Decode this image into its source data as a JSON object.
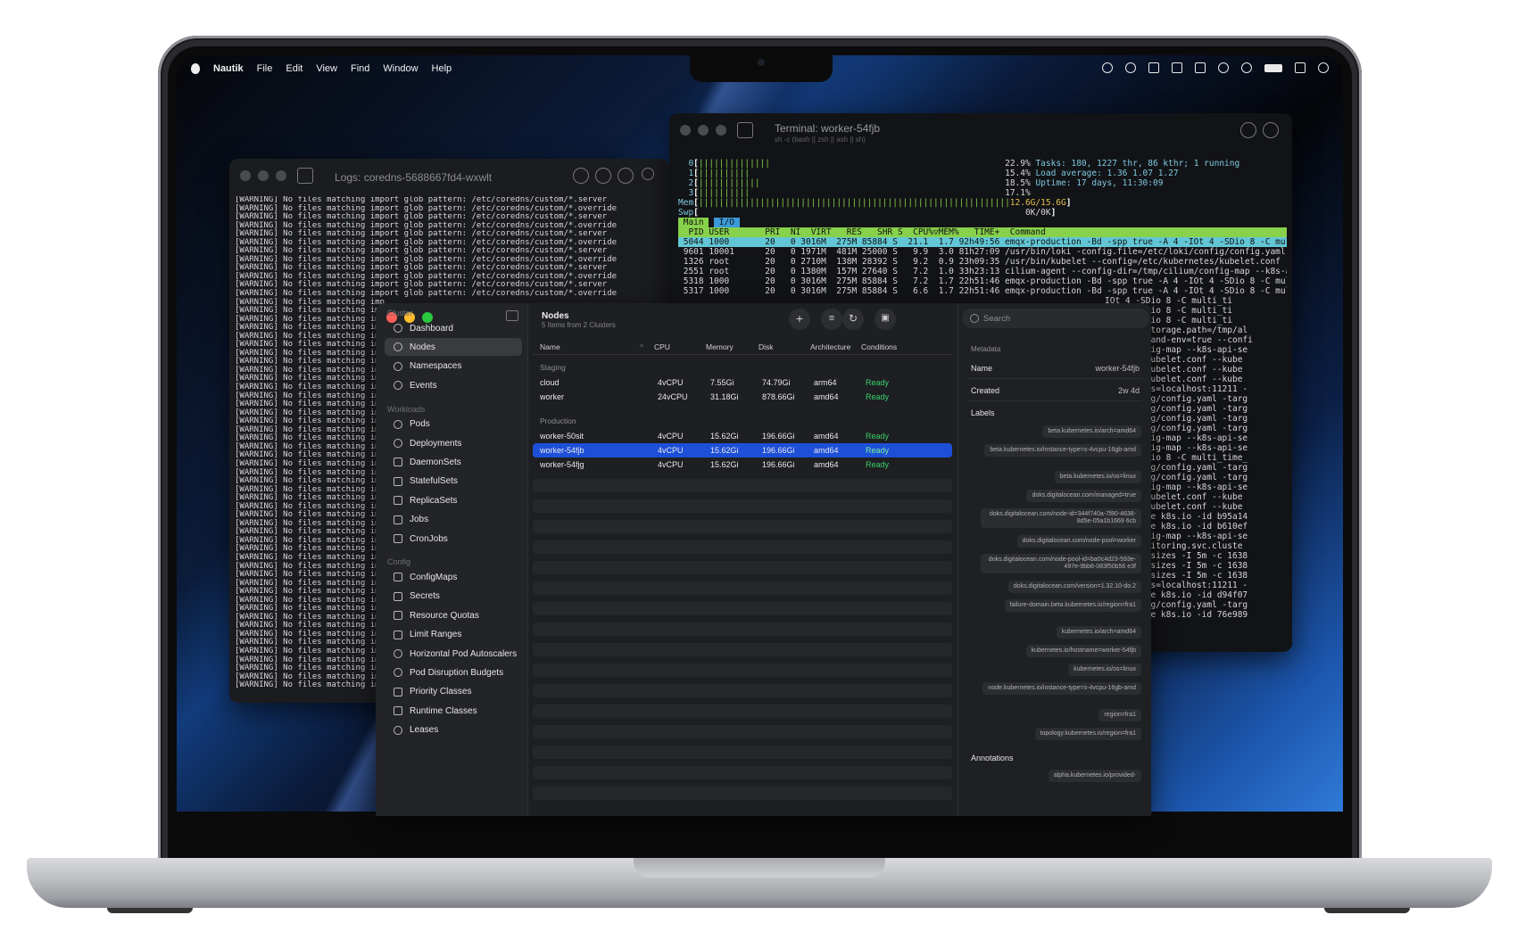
{
  "menubar": {
    "app": "Nautik",
    "items": [
      "File",
      "Edit",
      "View",
      "Find",
      "Window",
      "Help"
    ]
  },
  "logs_window": {
    "title": "Logs: coredns-5688667fd4-wxwlt",
    "lines": [
      "[WARNING] No files matching import glob pattern: /etc/coredns/custom/*.server",
      "[WARNING] No files matching import glob pattern: /etc/coredns/custom/*.override",
      "[WARNING] No files matching import glob pattern: /etc/coredns/custom/*.server",
      "[WARNING] No files matching import glob pattern: /etc/coredns/custom/*.override",
      "[WARNING] No files matching import glob pattern: /etc/coredns/custom/*.server",
      "[WARNING] No files matching import glob pattern: /etc/coredns/custom/*.override",
      "[WARNING] No files matching import glob pattern: /etc/coredns/custom/*.server",
      "[WARNING] No files matching import glob pattern: /etc/coredns/custom/*.override",
      "[WARNING] No files matching import glob pattern: /etc/coredns/custom/*.server",
      "[WARNING] No files matching import glob pattern: /etc/coredns/custom/*.override",
      "[WARNING] No files matching import glob pattern: /etc/coredns/custom/*.server",
      "[WARNING] No files matching import glob pattern: /etc/coredns/custom/*.override"
    ],
    "truncated_line": "[WARNING] No files matching imp",
    "truncated_count": 46
  },
  "terminal_window": {
    "title": "Terminal: worker-54fjb",
    "subtitle": "sh -c (bash || zsh || ash || sh)",
    "cpu_rows": [
      {
        "label": "0",
        "bar": "||||||||||||||",
        "pct": "22.9%"
      },
      {
        "label": "1",
        "bar": "||||||||||",
        "pct": "15.4%"
      },
      {
        "label": "2",
        "bar": "||||||||||||",
        "pct": "18.5%"
      },
      {
        "label": "3",
        "bar": "||||||||||",
        "pct": "17.1%"
      }
    ],
    "mem_bar": "|||||||||||||||||||||||||||||||||||||||||||||||||||||||||||||",
    "mem_value": "12.6G/15.6G",
    "swp_value": "0K/0K",
    "tasks": "Tasks: 180, 1227 thr, 86 kthr; 1 running",
    "load": "Load average: 1.36 1.07 1.27",
    "uptime": "Uptime: 17 days, 11:30:09",
    "tab_main": "Main",
    "tab_io": "I/O",
    "proc_header": "  PID USER       PRI  NI  VIRT   RES   SHR S  CPU%▽MEM%   TIME+  Command",
    "processes": [
      " 5044 1000       20   0 3016M  275M 85884 S  21.1  1.7 92h49:56 emqx-production -Bd -spp true -A 4 -IOt 4 -SDio 8 -C multi_ti",
      " 9601 10001      20   0 1971M  481M 25000 S   9.9  3.0 81h27:09 /usr/bin/loki -config.file=/etc/loki/config/config.yaml -targ",
      " 1326 root       20   0 2710M  138M 28392 S   9.2  0.9 23h09:35 /usr/bin/kubelet --config=/etc/kubernetes/kubelet.conf --kube",
      " 2551 root       20   0 1380M  157M 27640 S   7.2  1.0 33h23:13 cilium-agent --config-dir=/tmp/cilium/config-map --k8s-api-se",
      " 5318 1000       20   0 3016M  275M 85884 S   7.2  1.7 22h51:46 emqx-production -Bd -spp true -A 4 -IOt 4 -SDio 8 -C multi_ti",
      " 5317 1000       20   0 3016M  275M 85884 S   6.6  1.7 22h51:46 emqx-production -Bd -spp true -A 4 -IOt 4 -SDio 8 -C multi_ti"
    ],
    "right_fragments": [
      "IOt 4 -SDio 8 -C multi_ti",
      "IOt 4 -SDio 8 -C multi_ti",
      "IOt 4 -SDio 8 -C multi_ti",
      "alloy --storage.path=/tmp/al",
      "onfig.expand-env=true --confi",
      "lium/config-map --k8s-api-se",
      "ernetes/kubelet.conf --kube",
      "",
      "ernetes/kubelet.conf --kube",
      "ernetes/kubelet.conf --kube",
      "ed.address=localhost:11211 -",
      "oki/config/config.yaml -targ",
      "oki/config/config.yaml -targ",
      "oki/config/config.yaml -targ",
      "oki/config/config.yaml -targ",
      "lium/config-map --k8s-api-se",
      "",
      "lium/config-map --k8s-api-se",
      "IOt 4 -SDio 8 -C multi_time_",
      "oki/config/config.yaml -targ",
      "oki/config/config.yaml -targ",
      "lium/config-map --k8s-api-se",
      "ernetes/kubelet.conf --kube",
      "ernetes/kubelet.conf --kube",
      "-namespace k8s.io -id b95a14",
      "-namespace k8s.io -id b610ef",
      "lium/config-map --k8s-api-se",
      "teway.monitoring.svc.cluste",
      "rn,track_sizes -I 5m -c 1638",
      "rn,track_sizes -I 5m -c 1638",
      "rn,track_sizes -I 5m -c 1638",
      "ed.address=localhost:11211 -",
      "-namespace k8s.io -id d94f07",
      "oki/config/config.yaml -targ",
      "-namespace k8s.io -id 76e989"
    ]
  },
  "nautik": {
    "sidebar": {
      "sections": [
        {
          "title": "Cluster",
          "items": [
            "Dashboard",
            "Nodes",
            "Namespaces",
            "Events"
          ]
        },
        {
          "title": "Workloads",
          "items": [
            "Pods",
            "Deployments",
            "DaemonSets",
            "StatefulSets",
            "ReplicaSets",
            "Jobs",
            "CronJobs"
          ]
        },
        {
          "title": "Config",
          "items": [
            "ConfigMaps",
            "Secrets",
            "Resource Quotas",
            "Limit Ranges",
            "Horizontal Pod Autoscalers",
            "Pod Disruption Budgets",
            "Priority Classes",
            "Runtime Classes",
            "Leases"
          ]
        }
      ],
      "active": "Nodes"
    },
    "header": {
      "title": "Nodes",
      "subtitle": "5 Items from 2 Clusters"
    },
    "search_placeholder": "Search",
    "columns": [
      "Name",
      "CPU",
      "Memory",
      "Disk",
      "Architecture",
      "Conditions"
    ],
    "groups": [
      {
        "name": "Staging",
        "rows": [
          [
            "cloud",
            "4vCPU",
            "7.55Gi",
            "74.79Gi",
            "arm64",
            "Ready"
          ],
          [
            "worker",
            "24vCPU",
            "31.18Gi",
            "878.66Gi",
            "amd64",
            "Ready"
          ]
        ]
      },
      {
        "name": "Production",
        "rows": [
          [
            "worker-50sit",
            "4vCPU",
            "15.62Gi",
            "196.66Gi",
            "amd64",
            "Ready"
          ],
          [
            "worker-54fjb",
            "4vCPU",
            "15.62Gi",
            "196.66Gi",
            "amd64",
            "Ready"
          ],
          [
            "worker-54fjg",
            "4vCPU",
            "15.62Gi",
            "196.66Gi",
            "amd64",
            "Ready"
          ]
        ]
      }
    ],
    "selected_row": "worker-54fjb",
    "detail": {
      "section": "Metadata",
      "name_label": "Name",
      "name_value": "worker-54fjb",
      "created_label": "Created",
      "created_value": "2w 4d",
      "labels_title": "Labels",
      "labels": [
        "beta.kubernetes.io/arch=amd64",
        "beta.kubernetes.io/instance-type=s-4vcpu-16gb-amd",
        "beta.kubernetes.io/os=linux",
        "doks.digitalocean.com/managed=true",
        "doks.digitalocean.com/node-id=344f740a-7f80-4638-8d5e-05a1b1669 6cb",
        "doks.digitalocean.com/node-pool=worker",
        "doks.digitalocean.com/node-pool-id=ba0c4d23-593e-497e-9bb8-083f50b56 e3f",
        "doks.digitalocean.com/version=1.32.10-do.2",
        "failure-domain.beta.kubernetes.io/region=fra1",
        "kubernetes.io/arch=amd64",
        "kubernetes.io/hostname=worker-54fjb",
        "kubernetes.io/os=linux",
        "node.kubernetes.io/instance-type=s-4vcpu-16gb-amd",
        "region=fra1",
        "topology.kubernetes.io/region=fra1"
      ],
      "annotations_title": "Annotations",
      "annotation_first": "alpha.kubernetes.io/provided-"
    }
  }
}
